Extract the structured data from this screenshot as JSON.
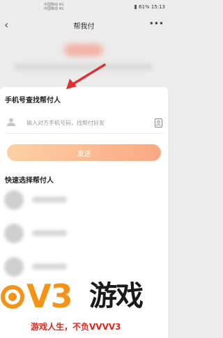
{
  "status_bar": {
    "carrier1": "中国移动 4G",
    "carrier2": "中国移动 4G",
    "battery": "61%",
    "time": "15:13"
  },
  "nav": {
    "back_icon": "chevron-left-icon",
    "title": "帮我付",
    "more_icon": "more-dots-icon"
  },
  "phone_lookup": {
    "label": "手机号查找帮付人",
    "input_placeholder": "输入对方手机号码，找帮付好友",
    "send_label": "发送"
  },
  "quick_select": {
    "label": "快速选择帮付人"
  },
  "watermark": {
    "brand": "V3",
    "word": "游戏",
    "slogan": "游戏人生，不负VVVV3"
  },
  "colors": {
    "accent_orange": "#f9a983",
    "arrow_red": "#e03131",
    "watermark_orange": "#f39318",
    "watermark_red": "#e2261b"
  }
}
